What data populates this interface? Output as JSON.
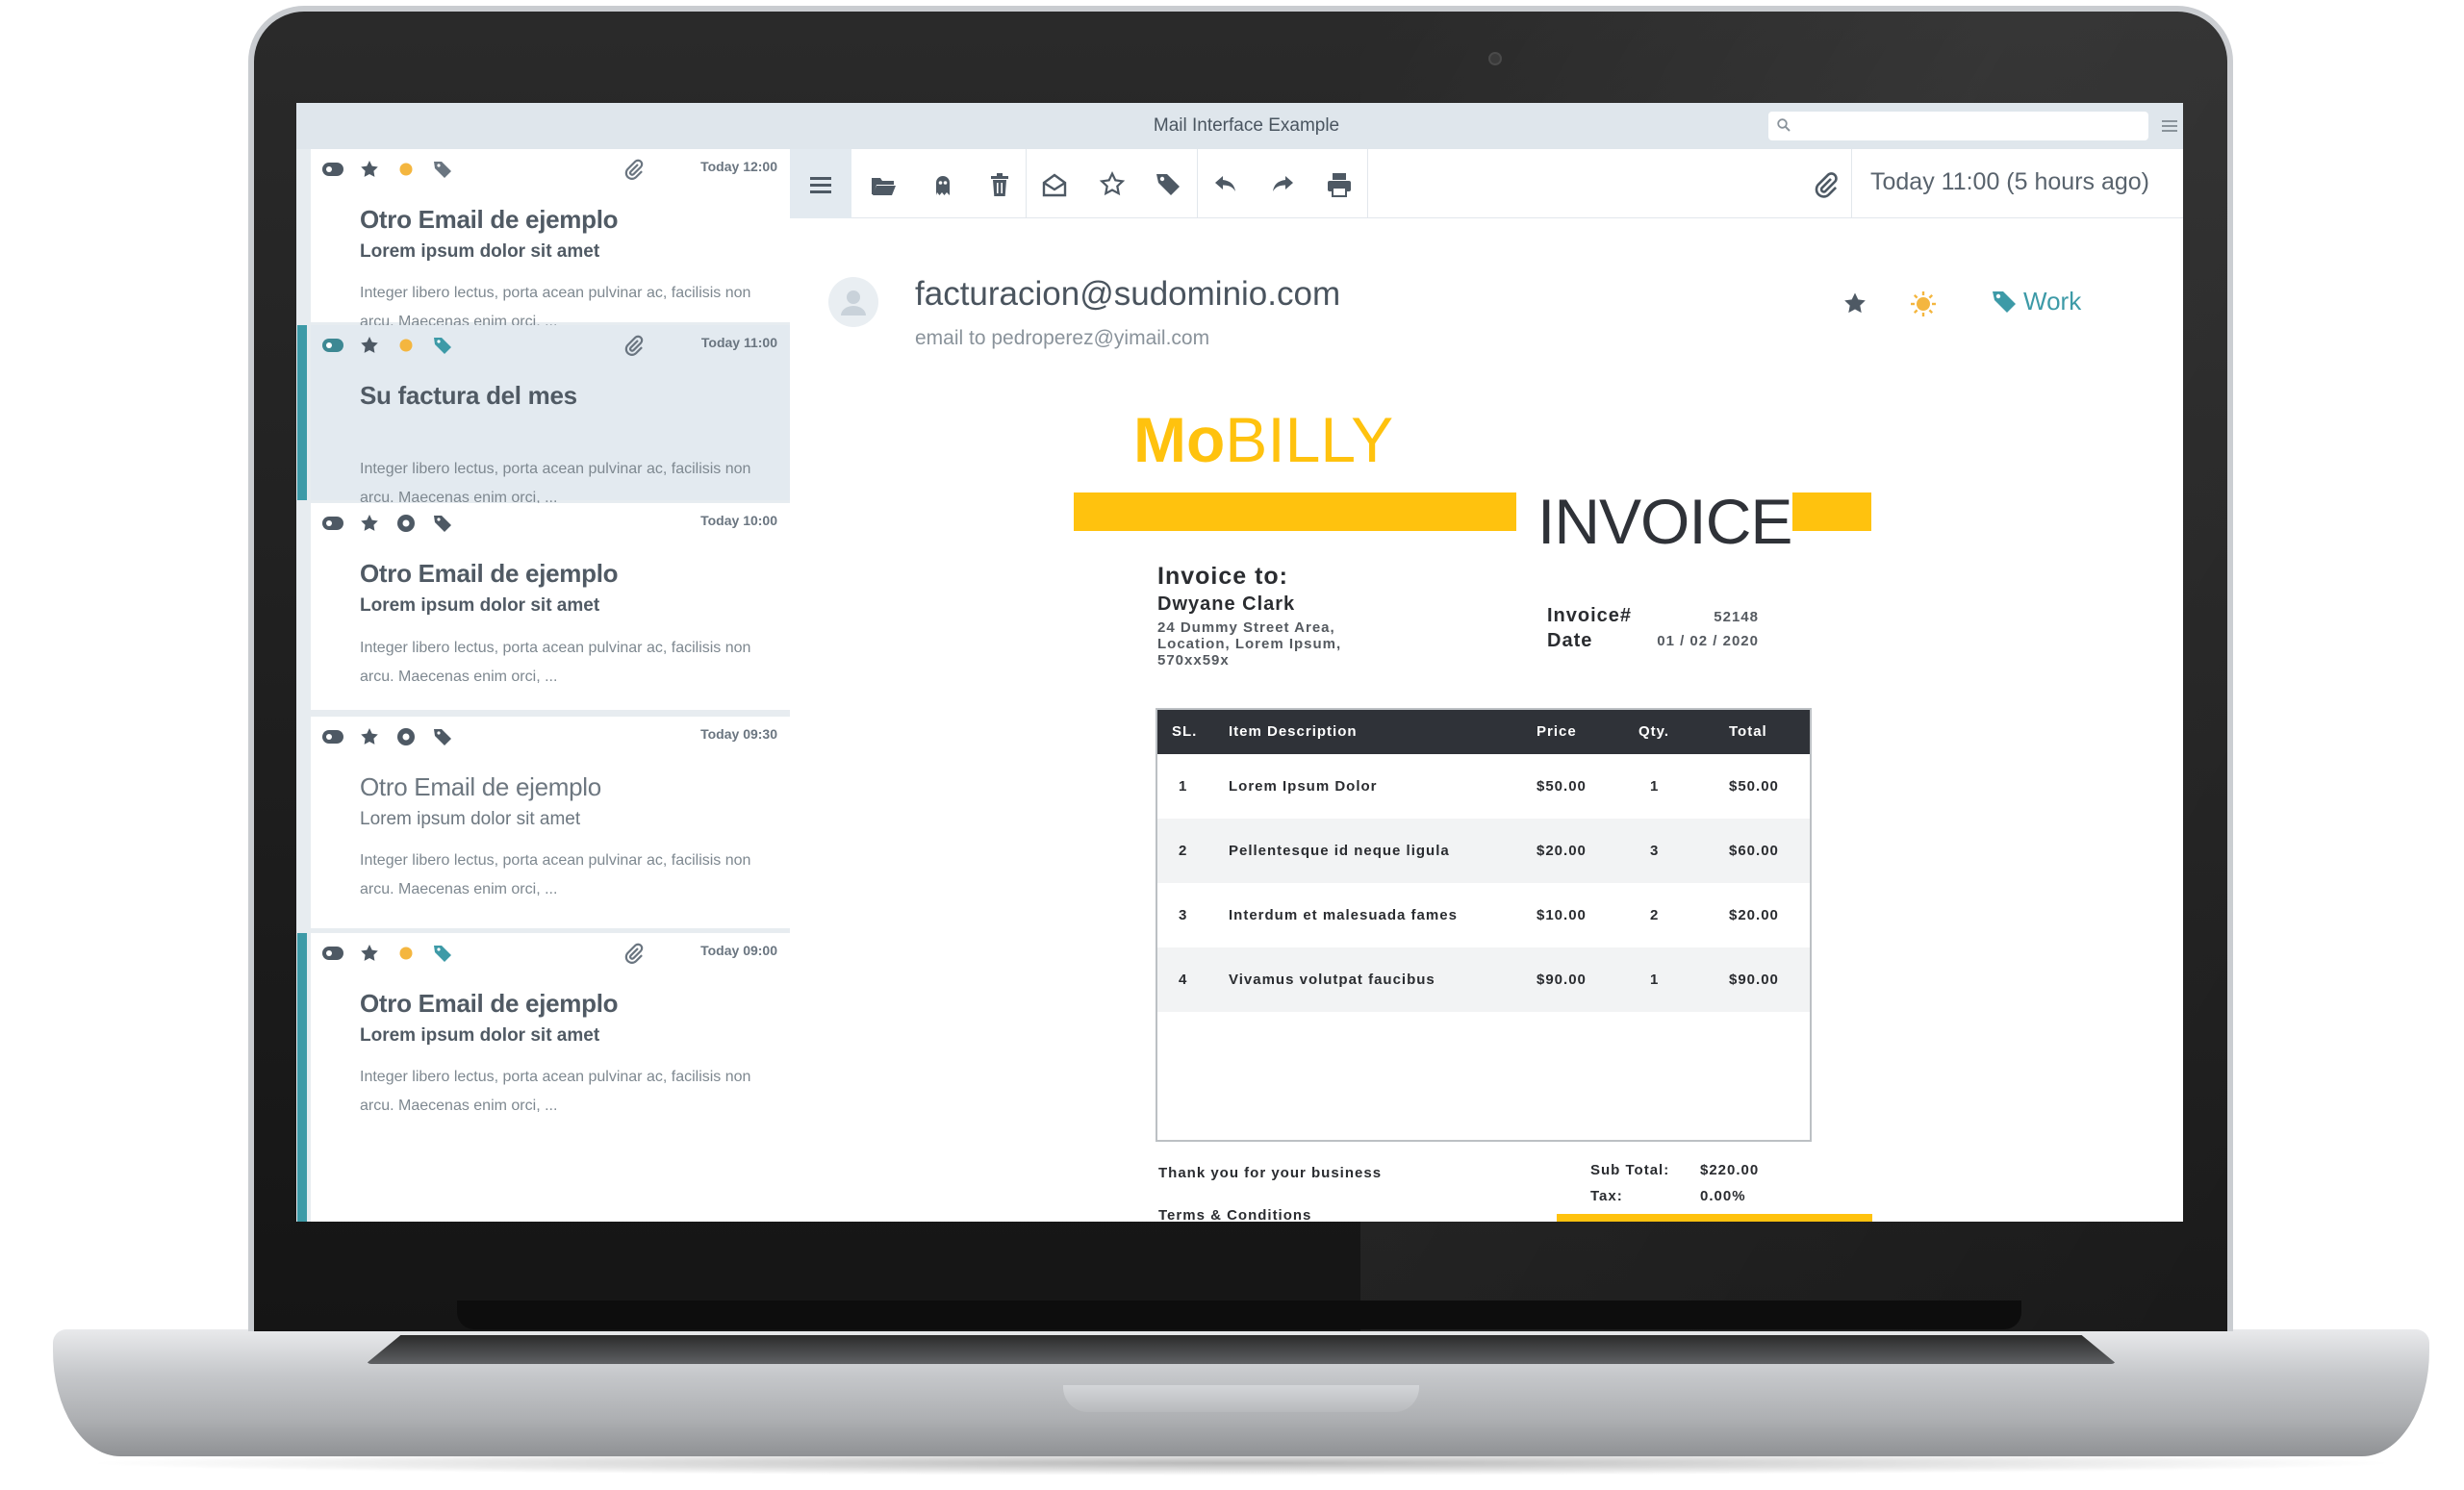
{
  "window": {
    "title": "Mail Interface Example"
  },
  "search": {
    "placeholder": "",
    "value": ""
  },
  "colors": {
    "accent": "#3d9aa7",
    "yellow": "#ffc20e",
    "dark": "#2f3238",
    "list_bg": "#e7ecf0"
  },
  "emails": [
    {
      "time": "Today 12:00",
      "subject": "Otro Email de ejemplo",
      "snippet": "Lorem ipsum dolor sit amet",
      "preview": "Integer libero lectus, porta acean pulvinar ac, facilisis non arcu. Maecenas enim orci, ...",
      "read": false,
      "selected": false,
      "accent": false,
      "colored_icons": true,
      "has_attachment": true
    },
    {
      "time": "Today 11:00",
      "subject": "Su factura del mes",
      "snippet": "",
      "preview": "Integer libero lectus, porta acean pulvinar ac, facilisis non arcu. Maecenas enim orci, ...",
      "read": false,
      "selected": true,
      "accent": true,
      "colored_icons": true,
      "has_attachment": true
    },
    {
      "time": "Today 10:00",
      "subject": "Otro Email de ejemplo",
      "snippet": "Lorem ipsum dolor sit amet",
      "preview": "Integer libero lectus, porta acean pulvinar ac, facilisis non arcu. Maecenas enim orci, ...",
      "read": false,
      "selected": false,
      "accent": false,
      "colored_icons": false,
      "has_attachment": false
    },
    {
      "time": "Today 09:30",
      "subject": "Otro Email de ejemplo",
      "snippet": "Lorem ipsum dolor sit amet",
      "preview": "Integer libero lectus, porta acean pulvinar ac, facilisis non arcu. Maecenas enim orci, ...",
      "read": true,
      "selected": false,
      "accent": false,
      "colored_icons": false,
      "has_attachment": false
    },
    {
      "time": "Today 09:00",
      "subject": "Otro Email de ejemplo",
      "snippet": "Lorem ipsum dolor sit amet",
      "preview": "Integer libero lectus, porta acean pulvinar ac, facilisis non arcu. Maecenas enim orci, ...",
      "read": false,
      "selected": false,
      "accent": true,
      "colored_icons": true,
      "has_attachment": true
    }
  ],
  "toolbar": {
    "icons": [
      "menu-icon",
      "folder-icon",
      "ghost-icon",
      "trash-icon",
      "envelope-open-icon",
      "star-icon",
      "tag-icon",
      "reply-icon",
      "forward-icon",
      "print-icon",
      "paperclip-icon"
    ],
    "date": "Today 11:00 (5 hours ago)"
  },
  "message": {
    "from": "facturacion@sudominio.com",
    "to": "email to pedroperez@yimail.com",
    "tag_label": "Work"
  },
  "invoice": {
    "logo_bold": "Mo",
    "logo_light": "BILLY",
    "title": "INVOICE",
    "to_heading": "Invoice to:",
    "customer": "Dwyane Clark",
    "address": "24 Dummy Street Area,\nLocation, Lorem Ipsum,\n570xx59x",
    "number_label": "Invoice#",
    "number": "52148",
    "date_label": "Date",
    "date": "01 / 02 / 2020",
    "columns": {
      "sl": "SL.",
      "desc": "Item Description",
      "price": "Price",
      "qty": "Qty.",
      "total": "Total"
    },
    "items": [
      {
        "sl": "1",
        "desc": "Lorem Ipsum Dolor",
        "price": "$50.00",
        "qty": "1",
        "total": "$50.00"
      },
      {
        "sl": "2",
        "desc": "Pellentesque id neque ligula",
        "price": "$20.00",
        "qty": "3",
        "total": "$60.00"
      },
      {
        "sl": "3",
        "desc": "Interdum et malesuada fames",
        "price": "$10.00",
        "qty": "2",
        "total": "$20.00"
      },
      {
        "sl": "4",
        "desc": "Vivamus volutpat faucibus",
        "price": "$90.00",
        "qty": "1",
        "total": "$90.00"
      }
    ],
    "thanks": "Thank you for your business",
    "terms": "Terms & Conditions",
    "subtotal_label": "Sub Total:",
    "subtotal": "$220.00",
    "tax_label": "Tax:",
    "tax": "0.00%"
  }
}
